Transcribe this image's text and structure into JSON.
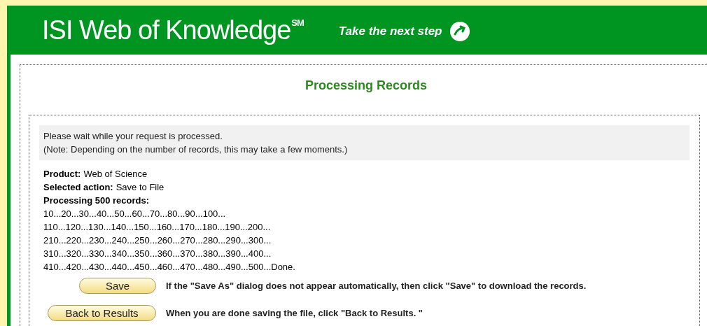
{
  "header": {
    "logo": "ISI Web of Knowledge",
    "logo_mark": "SM",
    "tagline": "Take the next step"
  },
  "page_title": "Processing Records",
  "notice": [
    "Please wait while your request is processed.",
    "(Note: Depending on the number of records, this may take a few moments.)"
  ],
  "details": [
    {
      "label": "Product:",
      "value": "Web of Science"
    },
    {
      "label": "Selected action:",
      "value": "Save to File"
    },
    {
      "label": "Processing 500 records:"
    }
  ],
  "progress_lines": [
    "10...20...30...40...50...60...70...80...90...100...",
    "110...120...130...140...150...160...170...180...190...200...",
    "210...220...230...240...250...260...270...280...290...300...",
    "310...320...330...340...350...360...370...380...390...400...",
    "410...420...430...440...450...460...470...480...490...500...Done."
  ],
  "actions": [
    {
      "button": "Save",
      "hint": "If the \"Save As\" dialog does not appear automatically, then click \"Save\" to download the records."
    },
    {
      "button": "Back to Results",
      "hint": "When you are done saving the file, click \"Back to Results. \""
    }
  ]
}
